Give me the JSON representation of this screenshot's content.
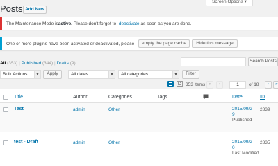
{
  "header": {
    "title": "Posts",
    "add_new": "Add New",
    "screen_options": "Screen Options ▾"
  },
  "notices": {
    "maintenance": {
      "text_before": "The Maintenance Mode is ",
      "bold": "active.",
      "text_middle": " Please don't forget to ",
      "link": "deactivate",
      "text_after": " as soon as you are done.",
      "accent": "#dc3232"
    },
    "plugins": {
      "text": "One or more plugins have been activated or deactivated, please",
      "empty_cache": "empty the page cache",
      "hide": "Hide this message",
      "accent": "#00a0d2"
    }
  },
  "subsubsub": {
    "all": "All",
    "all_count": "(353)",
    "published": "Published",
    "published_count": "(344)",
    "drafts": "Drafts",
    "drafts_count": "(9)"
  },
  "search": {
    "value": "",
    "button": "Search Posts"
  },
  "filters": {
    "bulk_actions": "Bulk Actions",
    "apply": "Apply",
    "dates": "All dates",
    "categories": "All categories",
    "filter": "Filter"
  },
  "pagination": {
    "items": "353 items",
    "first": "«",
    "prev": "‹",
    "current": "1",
    "of": "of 18",
    "next": "›",
    "last": "»"
  },
  "table": {
    "columns": {
      "title": "Title",
      "author": "Author",
      "categories": "Categories",
      "tags": "Tags",
      "date": "Date",
      "id": "ID"
    },
    "rows": [
      {
        "title": "Test",
        "author": "admin",
        "categories": "Other",
        "tags": "—",
        "comments": "—",
        "date_l1": "2015/09/2",
        "date_l2": "9",
        "status": "Published",
        "id": "2839"
      },
      {
        "title": "test - Draft",
        "author": "admin",
        "categories": "Other",
        "tags": "—",
        "comments": "—",
        "date_l1": "2015/09/2",
        "date_l2": "0",
        "status": "Last Modified",
        "id": "2835"
      }
    ]
  },
  "icons": {
    "list_view": "list-view-icon",
    "excerpt_view": "excerpt-view-icon",
    "comments": "comment-bubble-icon"
  },
  "colors": {
    "link": "#0073aa",
    "primary": "#0073aa",
    "background": "#f1f1f1"
  }
}
